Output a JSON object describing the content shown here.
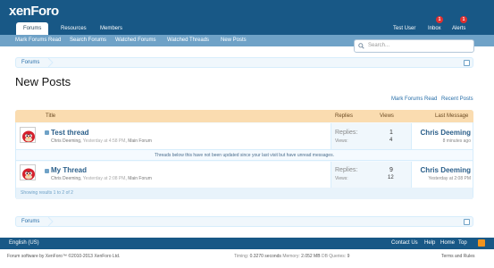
{
  "header": {
    "logo_text": "xenForo",
    "tabs": [
      {
        "label": "Forums",
        "selected": true
      },
      {
        "label": "Resources",
        "selected": false
      },
      {
        "label": "Members",
        "selected": false
      }
    ],
    "user": "Test User",
    "inbox": {
      "label": "Inbox",
      "count": "1"
    },
    "alerts": {
      "label": "Alerts",
      "count": "1"
    }
  },
  "subnav": [
    "Mark Forums Read",
    "Search Forums",
    "Watched Forums",
    "Watched Threads",
    "New Posts"
  ],
  "search": {
    "placeholder": "Search..."
  },
  "breadcrumb": {
    "label": "Forums"
  },
  "page_title": "New Posts",
  "top_links": {
    "mark_read": "Mark Forums Read",
    "recent": "Recent Posts"
  },
  "table": {
    "columns": {
      "title": "Title",
      "replies": "Replies",
      "views": "Views",
      "last": "Last Message"
    },
    "rows": [
      {
        "title": "Test thread",
        "author": "Chris Deeming",
        "time": "Yesterday at 4:58 PM",
        "forum": "Main Forum",
        "replies_label": "Replies:",
        "replies": "1",
        "views_label": "Views:",
        "views": "4",
        "last_user": "Chris Deeming",
        "last_time": "8 minutes ago"
      },
      {
        "title": "My Thread",
        "author": "Chris Deeming",
        "time": "Yesterday at 2:08 PM",
        "forum": "Main Forum",
        "replies_label": "Replies:",
        "replies": "9",
        "views_label": "Views:",
        "views": "12",
        "last_user": "Chris Deeming",
        "last_time": "Yesterday at 2:08 PM"
      }
    ],
    "separator": "Threads below this have not been updated since your last visit but have unread messages.",
    "showing": "Showing results 1 to 2 of 2"
  },
  "footer": {
    "language": "English (US)",
    "links": [
      "Contact Us",
      "Help",
      "Home",
      "Top"
    ],
    "copyright": "Forum software by XenForo™ ©2010-2013 XenForo Ltd.",
    "timing_label": "Timing:",
    "timing": "0.3270 seconds",
    "memory_label": "Memory:",
    "memory": "2.052 MB",
    "queries_label": "DB Queries:",
    "queries": "9",
    "terms": "Terms and Rules"
  },
  "colors": {
    "header": "#185886",
    "subnav": "#6fa2c7",
    "table_header": "#fadcb0",
    "link": "#2b5f8a"
  }
}
